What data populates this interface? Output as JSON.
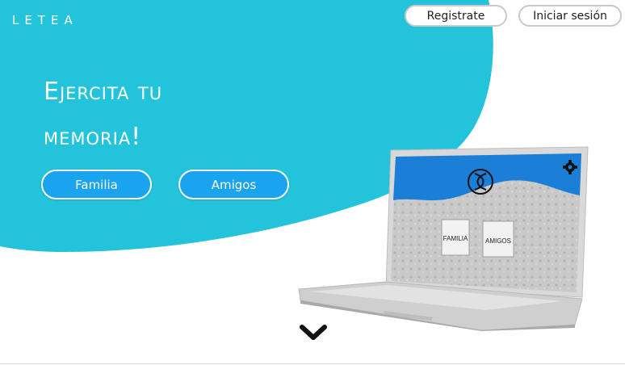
{
  "brand": {
    "logo": "LETEA"
  },
  "nav": {
    "register_label": "Registrate",
    "login_label": "Iniciar sesión"
  },
  "hero": {
    "headline_line1": "Ejercita tu",
    "headline_line2": "memoria!",
    "buttons": {
      "familia": "Familia",
      "amigos": "Amigos"
    }
  },
  "laptop_screen": {
    "cards": {
      "familia": "FAMILIA",
      "amigos": "AMIGOS"
    },
    "settings_icon": "gear-icon",
    "logo_icon": "infinity-knot-icon"
  },
  "scroll": {
    "icon": "chevron-down-icon"
  },
  "colors": {
    "hero": "#23c3db",
    "button": "#1aa3ee",
    "screen_top": "#1b7fd8"
  }
}
